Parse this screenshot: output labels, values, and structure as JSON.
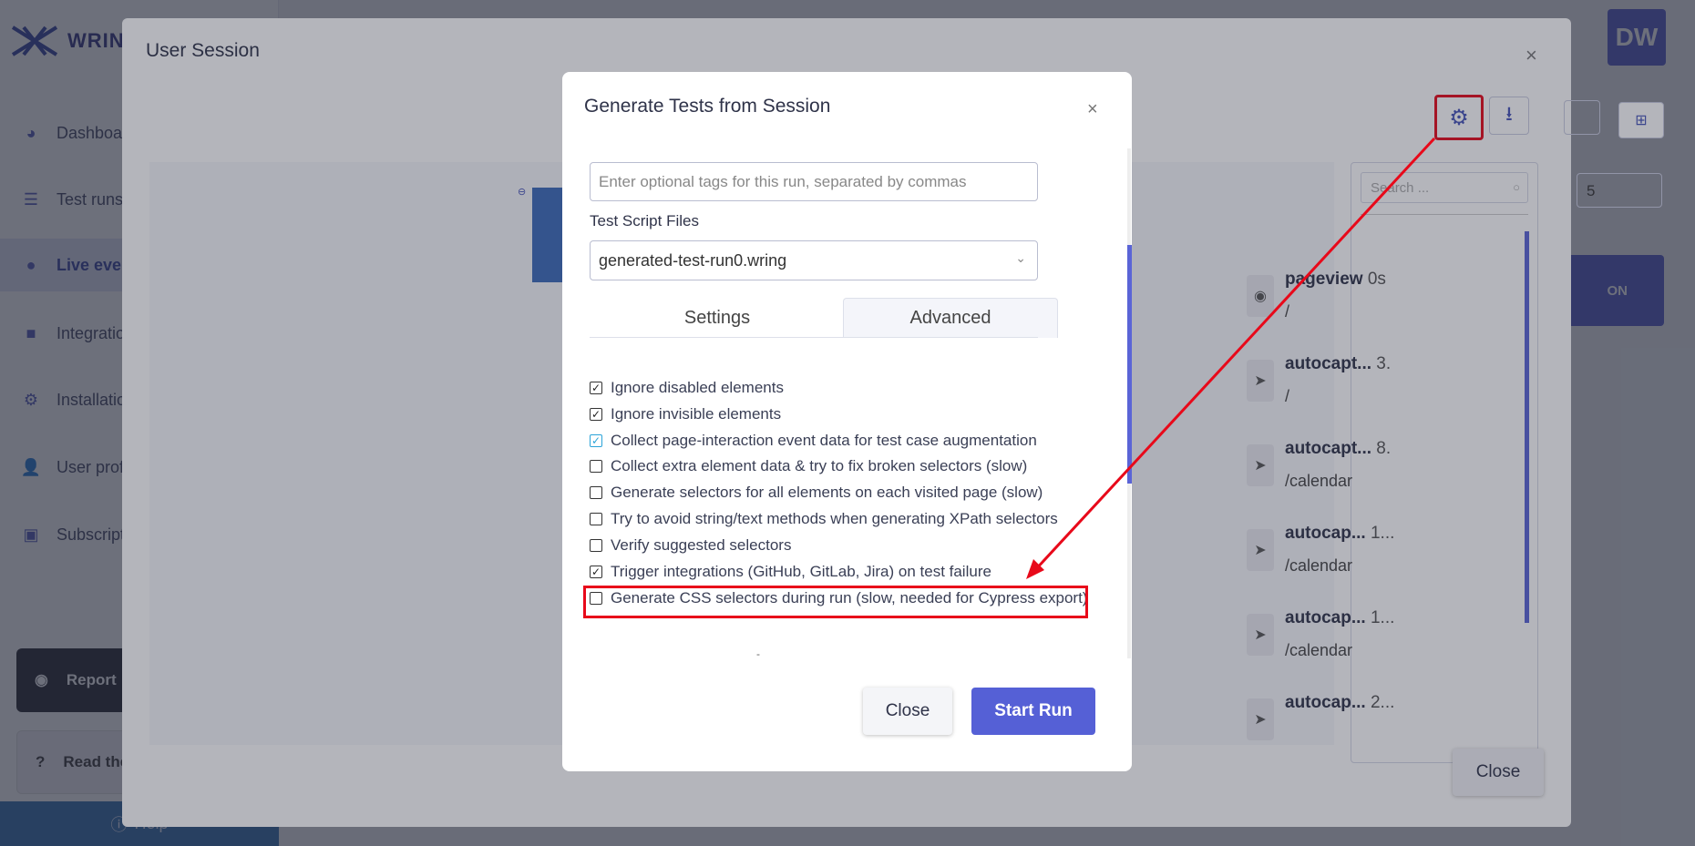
{
  "app": {
    "logo_text": "WRING",
    "avatar_initials": "DW"
  },
  "sidebar": {
    "items": [
      {
        "label": "Dashboard"
      },
      {
        "label": "Test runs"
      },
      {
        "label": "Live events"
      },
      {
        "label": "Integrations"
      },
      {
        "label": "Installation"
      },
      {
        "label": "User profile"
      },
      {
        "label": "Subscription"
      }
    ],
    "report_label": "Report",
    "read_label": "Read the docs",
    "help_label": "Help"
  },
  "session_modal": {
    "title": "User Session",
    "close_label": "Close",
    "search_placeholder": "Search ...",
    "page_size": "5",
    "action_label": "ON",
    "events": [
      {
        "name": "pageview",
        "time": "0s",
        "path": "/"
      },
      {
        "name": "autocapt...",
        "time": "3.",
        "path": "/"
      },
      {
        "name": "autocapt...",
        "time": "8.",
        "path": "/calendar"
      },
      {
        "name": "autocap...",
        "time": "1...",
        "path": "/calendar"
      },
      {
        "name": "autocap...",
        "time": "1...",
        "path": "/calendar"
      },
      {
        "name": "autocap...",
        "time": "2...",
        "path": ""
      }
    ]
  },
  "generate_modal": {
    "title": "Generate Tests from Session",
    "tags_placeholder": "Enter optional tags for this run, separated by commas",
    "files_label": "Test Script Files",
    "files_value": "generated-test-run0.wring",
    "tabs": [
      {
        "label": "Settings"
      },
      {
        "label": "Advanced"
      }
    ],
    "options": [
      {
        "label": "Ignore disabled elements",
        "checked": true
      },
      {
        "label": "Ignore invisible elements",
        "checked": true
      },
      {
        "label": "Collect page-interaction event data for test case augmentation",
        "checked": true
      },
      {
        "label": "Collect extra element data & try to fix broken selectors (slow)",
        "checked": false
      },
      {
        "label": "Generate selectors for all elements on each visited page (slow)",
        "checked": false
      },
      {
        "label": "Try to avoid string/text methods when generating XPath selectors",
        "checked": false
      },
      {
        "label": "Verify suggested selectors",
        "checked": false
      },
      {
        "label": "Trigger integrations (GitHub, GitLab, Jira) on test failure",
        "checked": true
      },
      {
        "label": "Generate CSS selectors during run (slow, needed for Cypress export)",
        "checked": false
      }
    ],
    "close_label": "Close",
    "start_label": "Start Run"
  },
  "colors": {
    "accent": "#5560d6",
    "annotation": "#e8091a"
  }
}
